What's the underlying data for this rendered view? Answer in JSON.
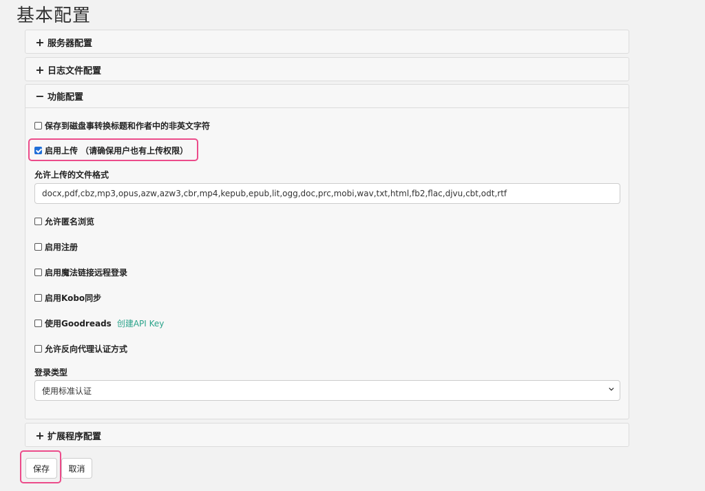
{
  "page": {
    "title": "基本配置"
  },
  "panels": {
    "server": {
      "sign": "+",
      "title": "服务器配置"
    },
    "log": {
      "sign": "+",
      "title": "日志文件配置"
    },
    "feature": {
      "sign": "−",
      "title": "功能配置"
    },
    "extension": {
      "sign": "+",
      "title": "扩展程序配置"
    }
  },
  "feature": {
    "convert_non_english": {
      "label": "保存到磁盘事转换标题和作者中的非英文字符",
      "checked": false
    },
    "enable_upload": {
      "label": "启用上传 （请确保用户也有上传权限）",
      "checked": true
    },
    "upload_formats_label": "允许上传的文件格式",
    "upload_formats_value": "docx,pdf,cbz,mp3,opus,azw,azw3,cbr,mp4,kepub,epub,lit,ogg,doc,prc,mobi,wav,txt,html,fb2,flac,djvu,cbt,odt,rtf",
    "anonymous_browse": {
      "label": "允许匿名浏览",
      "checked": false
    },
    "enable_register": {
      "label": "启用注册",
      "checked": false
    },
    "magic_link": {
      "label": "启用魔法链接远程登录",
      "checked": false
    },
    "kobo_sync": {
      "label": "启用Kobo同步",
      "checked": false
    },
    "goodreads": {
      "label": "使用Goodreads",
      "link": "创建API Key",
      "checked": false
    },
    "reverse_proxy": {
      "label": "允许反向代理认证方式",
      "checked": false
    },
    "login_type_label": "登录类型",
    "login_type_value": "使用标准认证"
  },
  "actions": {
    "save": "保存",
    "cancel": "取消"
  },
  "colors": {
    "highlight": "#ec4b8a",
    "link": "#2aa38a",
    "checkbox_checked": "#1f6fd8"
  }
}
